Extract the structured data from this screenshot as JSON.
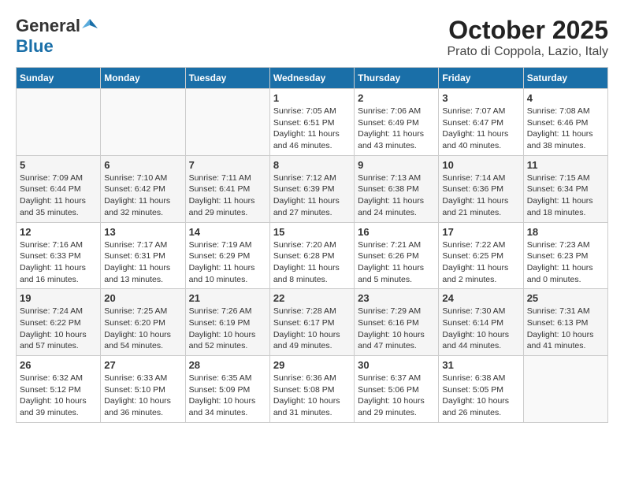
{
  "header": {
    "logo_general": "General",
    "logo_blue": "Blue",
    "month": "October 2025",
    "location": "Prato di Coppola, Lazio, Italy"
  },
  "days_of_week": [
    "Sunday",
    "Monday",
    "Tuesday",
    "Wednesday",
    "Thursday",
    "Friday",
    "Saturday"
  ],
  "weeks": [
    [
      {
        "day": "",
        "info": ""
      },
      {
        "day": "",
        "info": ""
      },
      {
        "day": "",
        "info": ""
      },
      {
        "day": "1",
        "info": "Sunrise: 7:05 AM\nSunset: 6:51 PM\nDaylight: 11 hours and 46 minutes."
      },
      {
        "day": "2",
        "info": "Sunrise: 7:06 AM\nSunset: 6:49 PM\nDaylight: 11 hours and 43 minutes."
      },
      {
        "day": "3",
        "info": "Sunrise: 7:07 AM\nSunset: 6:47 PM\nDaylight: 11 hours and 40 minutes."
      },
      {
        "day": "4",
        "info": "Sunrise: 7:08 AM\nSunset: 6:46 PM\nDaylight: 11 hours and 38 minutes."
      }
    ],
    [
      {
        "day": "5",
        "info": "Sunrise: 7:09 AM\nSunset: 6:44 PM\nDaylight: 11 hours and 35 minutes."
      },
      {
        "day": "6",
        "info": "Sunrise: 7:10 AM\nSunset: 6:42 PM\nDaylight: 11 hours and 32 minutes."
      },
      {
        "day": "7",
        "info": "Sunrise: 7:11 AM\nSunset: 6:41 PM\nDaylight: 11 hours and 29 minutes."
      },
      {
        "day": "8",
        "info": "Sunrise: 7:12 AM\nSunset: 6:39 PM\nDaylight: 11 hours and 27 minutes."
      },
      {
        "day": "9",
        "info": "Sunrise: 7:13 AM\nSunset: 6:38 PM\nDaylight: 11 hours and 24 minutes."
      },
      {
        "day": "10",
        "info": "Sunrise: 7:14 AM\nSunset: 6:36 PM\nDaylight: 11 hours and 21 minutes."
      },
      {
        "day": "11",
        "info": "Sunrise: 7:15 AM\nSunset: 6:34 PM\nDaylight: 11 hours and 18 minutes."
      }
    ],
    [
      {
        "day": "12",
        "info": "Sunrise: 7:16 AM\nSunset: 6:33 PM\nDaylight: 11 hours and 16 minutes."
      },
      {
        "day": "13",
        "info": "Sunrise: 7:17 AM\nSunset: 6:31 PM\nDaylight: 11 hours and 13 minutes."
      },
      {
        "day": "14",
        "info": "Sunrise: 7:19 AM\nSunset: 6:29 PM\nDaylight: 11 hours and 10 minutes."
      },
      {
        "day": "15",
        "info": "Sunrise: 7:20 AM\nSunset: 6:28 PM\nDaylight: 11 hours and 8 minutes."
      },
      {
        "day": "16",
        "info": "Sunrise: 7:21 AM\nSunset: 6:26 PM\nDaylight: 11 hours and 5 minutes."
      },
      {
        "day": "17",
        "info": "Sunrise: 7:22 AM\nSunset: 6:25 PM\nDaylight: 11 hours and 2 minutes."
      },
      {
        "day": "18",
        "info": "Sunrise: 7:23 AM\nSunset: 6:23 PM\nDaylight: 11 hours and 0 minutes."
      }
    ],
    [
      {
        "day": "19",
        "info": "Sunrise: 7:24 AM\nSunset: 6:22 PM\nDaylight: 10 hours and 57 minutes."
      },
      {
        "day": "20",
        "info": "Sunrise: 7:25 AM\nSunset: 6:20 PM\nDaylight: 10 hours and 54 minutes."
      },
      {
        "day": "21",
        "info": "Sunrise: 7:26 AM\nSunset: 6:19 PM\nDaylight: 10 hours and 52 minutes."
      },
      {
        "day": "22",
        "info": "Sunrise: 7:28 AM\nSunset: 6:17 PM\nDaylight: 10 hours and 49 minutes."
      },
      {
        "day": "23",
        "info": "Sunrise: 7:29 AM\nSunset: 6:16 PM\nDaylight: 10 hours and 47 minutes."
      },
      {
        "day": "24",
        "info": "Sunrise: 7:30 AM\nSunset: 6:14 PM\nDaylight: 10 hours and 44 minutes."
      },
      {
        "day": "25",
        "info": "Sunrise: 7:31 AM\nSunset: 6:13 PM\nDaylight: 10 hours and 41 minutes."
      }
    ],
    [
      {
        "day": "26",
        "info": "Sunrise: 6:32 AM\nSunset: 5:12 PM\nDaylight: 10 hours and 39 minutes."
      },
      {
        "day": "27",
        "info": "Sunrise: 6:33 AM\nSunset: 5:10 PM\nDaylight: 10 hours and 36 minutes."
      },
      {
        "day": "28",
        "info": "Sunrise: 6:35 AM\nSunset: 5:09 PM\nDaylight: 10 hours and 34 minutes."
      },
      {
        "day": "29",
        "info": "Sunrise: 6:36 AM\nSunset: 5:08 PM\nDaylight: 10 hours and 31 minutes."
      },
      {
        "day": "30",
        "info": "Sunrise: 6:37 AM\nSunset: 5:06 PM\nDaylight: 10 hours and 29 minutes."
      },
      {
        "day": "31",
        "info": "Sunrise: 6:38 AM\nSunset: 5:05 PM\nDaylight: 10 hours and 26 minutes."
      },
      {
        "day": "",
        "info": ""
      }
    ]
  ]
}
